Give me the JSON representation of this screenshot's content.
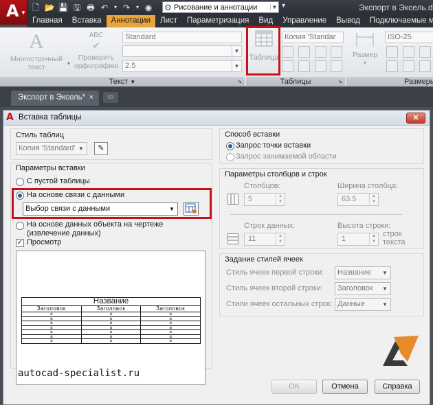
{
  "titlebar": {
    "app_letter": "A",
    "workspace": "Рисование и аннотации",
    "title": "Экспорт в Эксель.dw"
  },
  "ribbon_tabs": [
    "Главная",
    "Вставка",
    "Аннотации",
    "Лист",
    "Параметризация",
    "Вид",
    "Управление",
    "Вывод",
    "Подключаемые мо"
  ],
  "active_tab": "Аннотации",
  "ribbon": {
    "text_panel": {
      "mtext_label": "Многострочный текст",
      "spell_label": "Проверить орфографию",
      "spell_icon_text": "ABC",
      "style_combo": "Standard",
      "height_combo": "2.5",
      "panel_label": "Текст"
    },
    "tables_panel": {
      "table_label": "Таблица",
      "style_combo": "Копия 'Standar",
      "panel_label": "Таблицы"
    },
    "dims_panel": {
      "size_label": "Размер",
      "style_combo": "ISO-25",
      "panel_label": "Размеры"
    }
  },
  "doc_tab": {
    "label": "Экспорт в Эксель*",
    "close": "×"
  },
  "dialog": {
    "title": "Вставка таблицы",
    "close": "✕",
    "table_style_label": "Стиль таблиц",
    "table_style_value": "Копия 'Standard'",
    "insert_options_label": "Параметры вставки",
    "opt_empty": "С пустой таблицы",
    "opt_link": "На основе связи с данными",
    "link_combo_value": "Выбор связи с данными",
    "opt_object": "На основе данных объекта на чертеже (извлечение данных)",
    "preview_label": "Просмотр",
    "insert_method_label": "Способ вставки",
    "method_point": "Запрос точки вставки",
    "method_area": "Запрос занимаемой области",
    "colrow_label": "Параметры столбцов и строк",
    "columns_label": "Столбцов:",
    "columns_value": "5",
    "col_width_label": "Ширина столбца:",
    "col_width_value": "63.5",
    "data_rows_label": "Строк данных:",
    "data_rows_value": "11",
    "row_height_label": "Высота строки:",
    "row_height_value": "1",
    "row_height_unit": "строк текста",
    "cell_styles_label": "Задание стилей ячеек",
    "first_row_label": "Стиль ячеек первой строки:",
    "first_row_value": "Название",
    "second_row_label": "Стиль ячеек второй строки:",
    "second_row_value": "Заголовок",
    "other_rows_label": "Стили ячеек остальных строк:",
    "other_rows_value": "Данные",
    "ok": "OK",
    "cancel": "Отмена",
    "help": "Справка"
  },
  "preview": {
    "title": "Название",
    "headers": [
      "Заголовок",
      "Заголовок",
      "Заголовок"
    ],
    "cell_mark": "≡"
  },
  "watermark": "autocad-specialist.ru",
  "colors": {
    "accent_tab": "#e9a53b",
    "highlight": "#c8101a",
    "logo_red": "#b31318"
  }
}
